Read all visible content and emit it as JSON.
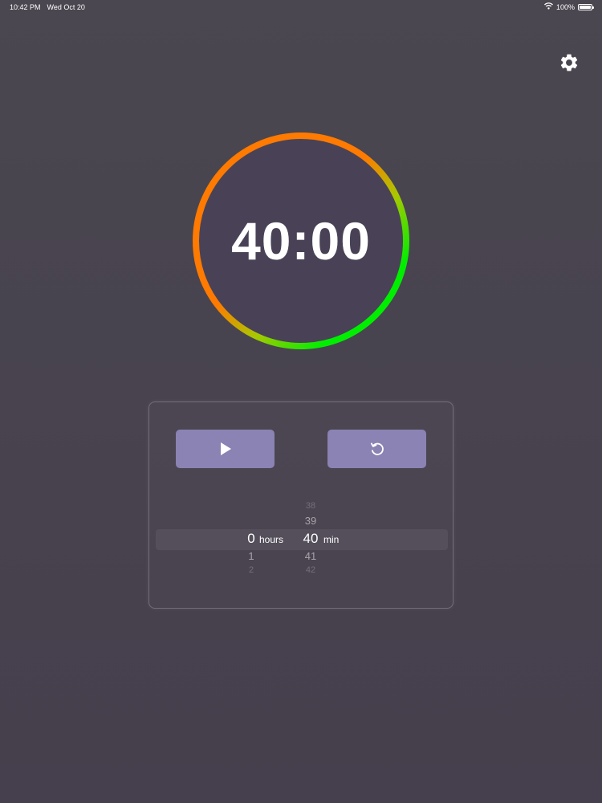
{
  "status_bar": {
    "time": "10:42 PM",
    "date": "Wed Oct 20",
    "battery": "100%",
    "icons": [
      "wifi-icon",
      "battery-icon"
    ]
  },
  "toolbar": {
    "settings_icon": "gear-icon"
  },
  "timer": {
    "display": "40:00",
    "ring_colors": [
      "#ff7a00",
      "#00ee00"
    ]
  },
  "controls": {
    "play_icon": "play-icon",
    "reset_icon": "reset-icon",
    "button_color": "#8a83b3"
  },
  "picker": {
    "hours": {
      "above": [
        "",
        ""
      ],
      "selected": "0",
      "below": [
        "1",
        "2"
      ],
      "unit": "hours"
    },
    "minutes": {
      "above": [
        "38",
        "39"
      ],
      "selected": "40",
      "below": [
        "41",
        "42"
      ],
      "unit": "min"
    }
  }
}
